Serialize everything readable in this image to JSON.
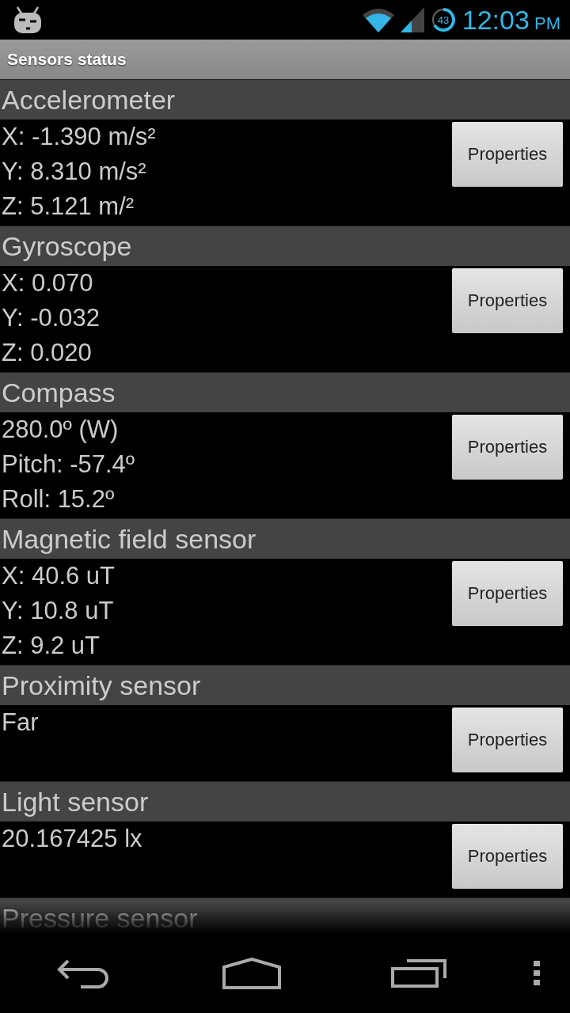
{
  "status_bar": {
    "battery": "43",
    "time": "12:03",
    "time_suffix": "PM"
  },
  "title_bar": {
    "title": "Sensors status"
  },
  "sensors": [
    {
      "name": "Accelerometer",
      "readings": [
        "X: -1.390 m/s²",
        "Y: 8.310 m/s²",
        "Z: 5.121 m/²"
      ],
      "button": "Properties"
    },
    {
      "name": "Gyroscope",
      "readings": [
        "X: 0.070",
        "Y: -0.032",
        "Z: 0.020"
      ],
      "button": "Properties"
    },
    {
      "name": "Compass",
      "readings": [
        "280.0º (W)",
        "Pitch: -57.4º",
        "Roll: 15.2º"
      ],
      "button": "Properties"
    },
    {
      "name": "Magnetic field sensor",
      "readings": [
        "X: 40.6 uT",
        "Y: 10.8 uT",
        "Z: 9.2 uT"
      ],
      "button": "Properties"
    },
    {
      "name": "Proximity sensor",
      "readings": [
        "Far"
      ],
      "button": "Properties"
    },
    {
      "name": "Light sensor",
      "readings": [
        "20.167425 lx"
      ],
      "button": "Properties"
    },
    {
      "name": "Pressure sensor"
    }
  ]
}
